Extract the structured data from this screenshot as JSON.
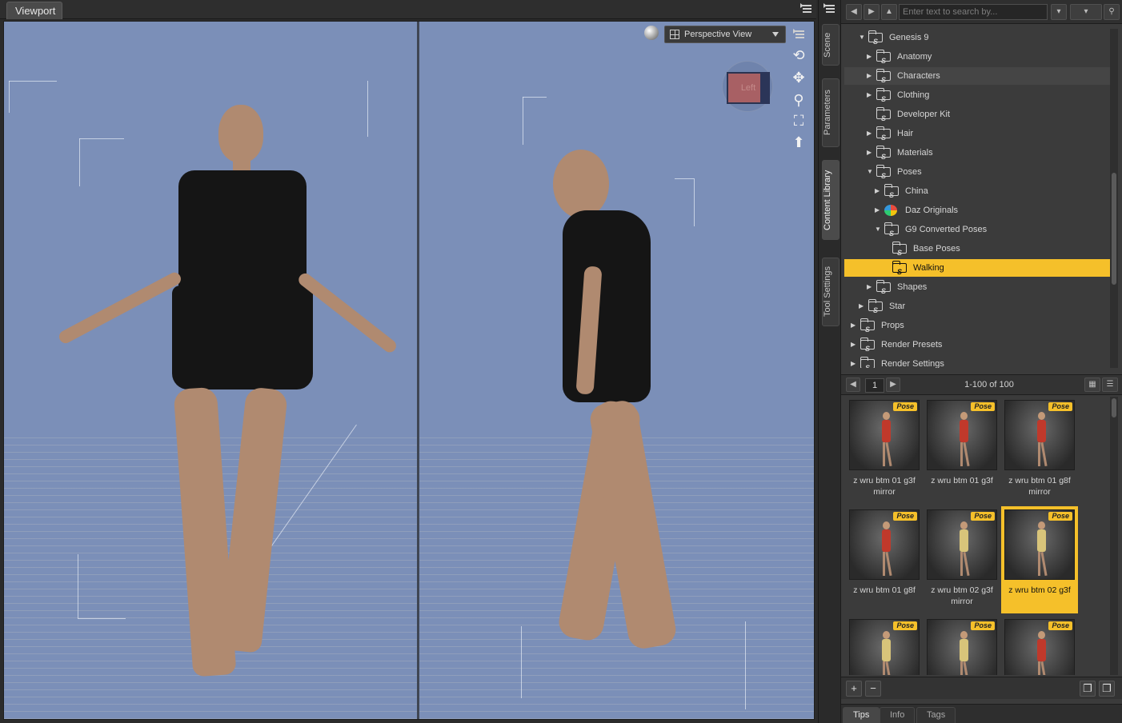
{
  "viewport": {
    "tab_label": "Viewport",
    "view_dropdown": "Perspective View",
    "cube_face_label": "Left",
    "nav_tools": [
      "orbit-icon",
      "pan-icon",
      "zoom-icon",
      "frame-icon",
      "reset-view-icon"
    ]
  },
  "side_tabs": [
    "Scene",
    "Parameters",
    "Content Library",
    "Tool Settings"
  ],
  "active_side_tab": "Content Library",
  "content_library": {
    "search_placeholder": "Enter text to search by...",
    "tree": [
      {
        "label": "Genesis 9",
        "depth": 2,
        "expanded": true
      },
      {
        "label": "Anatomy",
        "depth": 3,
        "expanded": false
      },
      {
        "label": "Characters",
        "depth": 3,
        "expanded": false,
        "hover": true
      },
      {
        "label": "Clothing",
        "depth": 3,
        "expanded": false
      },
      {
        "label": "Developer Kit",
        "depth": 3,
        "leaf": true
      },
      {
        "label": "Hair",
        "depth": 3,
        "expanded": false
      },
      {
        "label": "Materials",
        "depth": 3,
        "expanded": false
      },
      {
        "label": "Poses",
        "depth": 3,
        "expanded": true
      },
      {
        "label": "China",
        "depth": 4,
        "expanded": false
      },
      {
        "label": "Daz Originals",
        "depth": 4,
        "expanded": false,
        "daz": true
      },
      {
        "label": "G9 Converted Poses",
        "depth": 4,
        "expanded": true
      },
      {
        "label": "Base Poses",
        "depth": 5,
        "leaf": true
      },
      {
        "label": "Walking",
        "depth": 5,
        "leaf": true,
        "selected": true
      },
      {
        "label": "Shapes",
        "depth": 3,
        "expanded": false
      },
      {
        "label": "Star",
        "depth": 2,
        "expanded": false
      },
      {
        "label": "Props",
        "depth": 1,
        "expanded": false
      },
      {
        "label": "Render Presets",
        "depth": 1,
        "expanded": false
      },
      {
        "label": "Render Settings",
        "depth": 1,
        "expanded": false
      }
    ],
    "pager": {
      "page": "1",
      "count": "1-100 of 100"
    },
    "badge_label": "Pose",
    "items": [
      {
        "label": "z wru btm 01 g3f mirror",
        "outfit": "#c0392b"
      },
      {
        "label": "z wru btm 01 g3f",
        "outfit": "#c0392b"
      },
      {
        "label": "z wru btm 01 g8f mirror",
        "outfit": "#c0392b"
      },
      {
        "label": "z wru btm 01 g8f",
        "outfit": "#c0392b"
      },
      {
        "label": "z wru btm 02 g3f mirror",
        "outfit": "#d8c47a"
      },
      {
        "label": "z wru btm 02 g3f",
        "outfit": "#d8c47a",
        "selected": true
      },
      {
        "label": "",
        "outfit": "#d8c47a"
      },
      {
        "label": "",
        "outfit": "#d8c47a"
      },
      {
        "label": "",
        "outfit": "#c0392b"
      }
    ],
    "info_tabs": [
      "Tips",
      "Info",
      "Tags"
    ],
    "active_info_tab": "Tips"
  },
  "colors": {
    "viewport_bg": "#7b8fb8",
    "selection": "#f5c02a"
  }
}
